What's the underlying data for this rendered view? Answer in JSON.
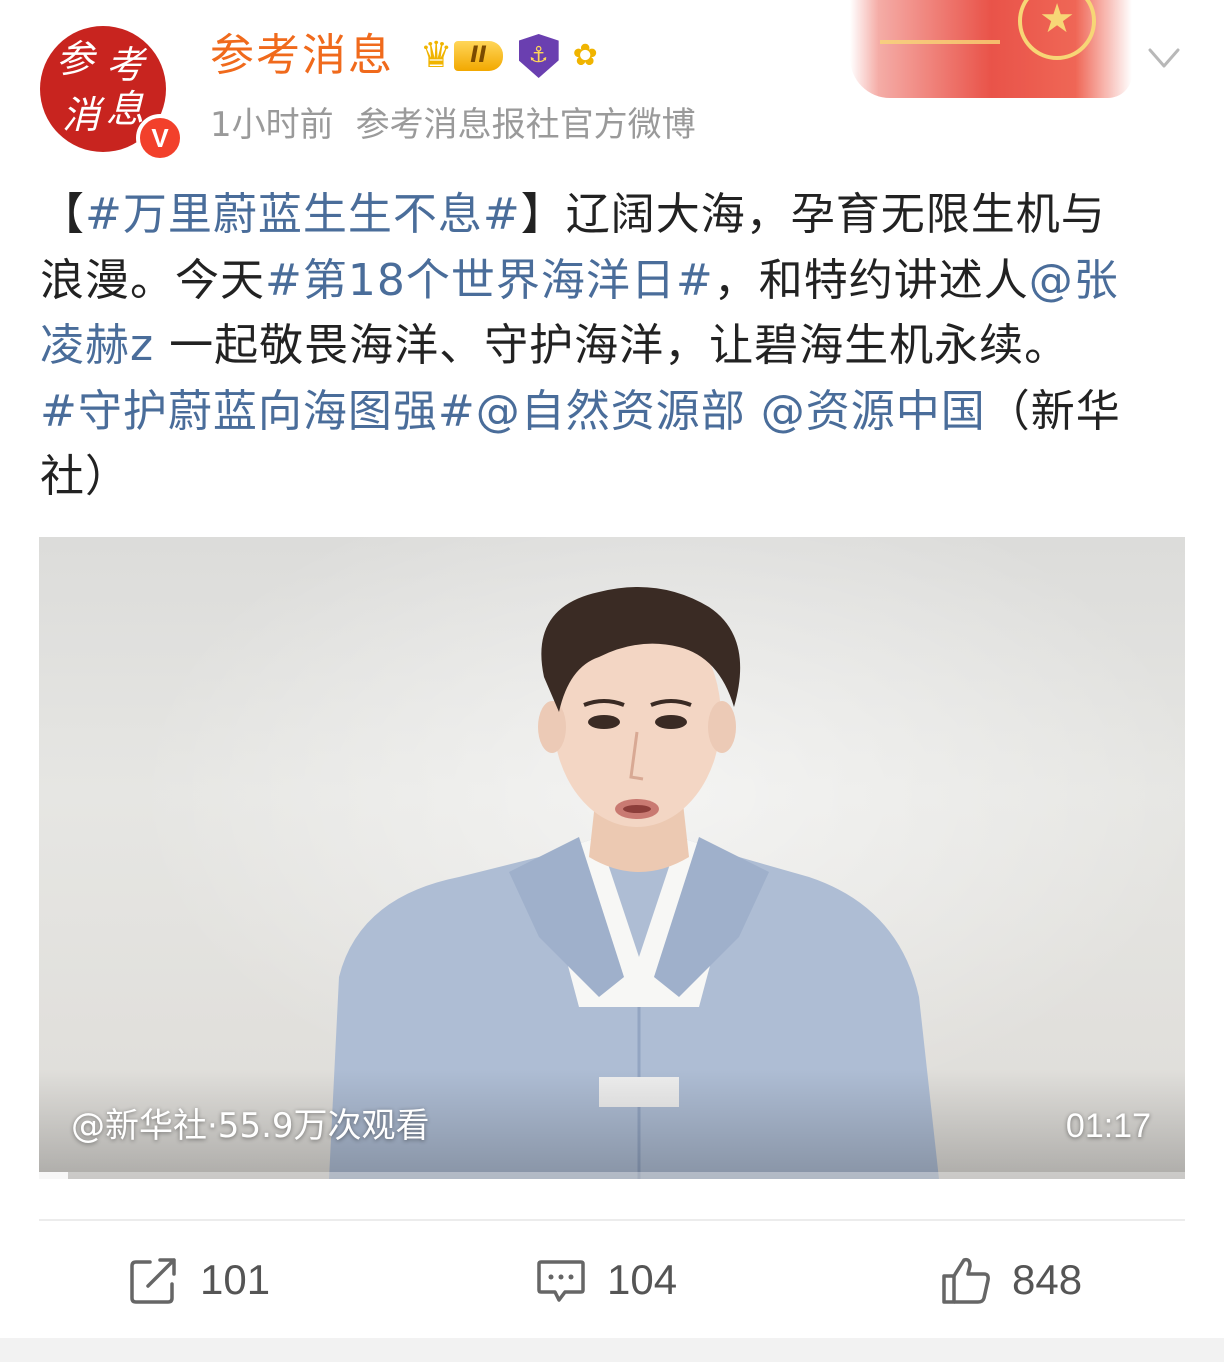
{
  "post": {
    "author": {
      "name": "参考消息",
      "avatar_text": [
        "参",
        "考",
        "消",
        "息"
      ],
      "verified_mark": "V",
      "level_badge": "II"
    },
    "time": "1小时前",
    "source": "参考消息报社官方微博",
    "text": {
      "line1": {
        "bracket_open": "【",
        "topic1": "#万里蔚蓝生生不息#",
        "bracket_close": "】",
        "plain1": "辽阔大海，孕育无限生机与"
      },
      "line2": {
        "plain1": "浪漫。今天",
        "topic2": "#第18个世界海洋日#",
        "plain2": "，和特约讲述人",
        "mention1_part1": "@张"
      },
      "line3": {
        "mention1_part2": "凌赫z",
        "plain1": " 一起敬畏海洋、守护海洋，让碧海生机永续。"
      },
      "line4": {
        "topic3": "#守护蔚蓝向海图强#",
        "mention2": "@自然资源部",
        "mention3": "@资源中国",
        "plain1": "（新华"
      },
      "line5": {
        "plain1": "社）"
      }
    },
    "video": {
      "caption": "@新华社·55.9万次观看",
      "duration": "01:17",
      "progress": 0.025
    },
    "actions": {
      "repost_count": "101",
      "comment_count": "104",
      "like_count": "848"
    }
  },
  "colors": {
    "username": "#f06a1c",
    "link": "#4a6d9a",
    "meta": "#9a9a9a",
    "verified_badge": "#f2402b",
    "avatar_bg": "#c8241f"
  }
}
